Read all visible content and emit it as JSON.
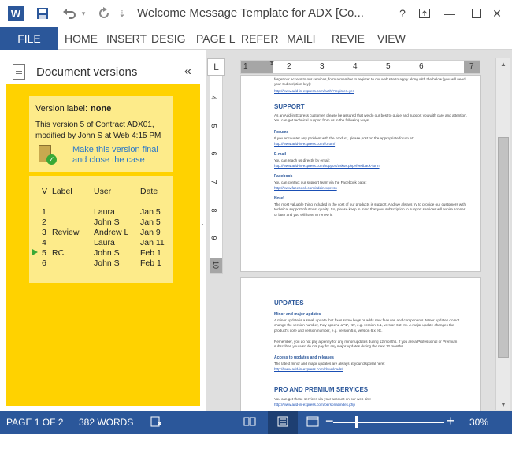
{
  "app": {
    "title": "Welcome Message Template for ADX [Co...",
    "logo_letter": "W"
  },
  "qat": {
    "save_icon": "save-icon",
    "undo_icon": "undo-icon",
    "redo_icon": "redo-icon"
  },
  "window": {
    "help": "?",
    "ribbon_display": "▣",
    "minimize": "—",
    "close": "✕"
  },
  "ribbon": {
    "file": "FILE",
    "tabs": [
      "HOME",
      "INSERT",
      "DESIG",
      "PAGE L",
      "REFER",
      "MAILI",
      "REVIE",
      "VIEW"
    ]
  },
  "pane": {
    "title": "Document versions",
    "collapse": "«",
    "version_label_prefix": "Version label:",
    "version_label_value": "none",
    "version_info": "This version 5 of Contract ADX01, modified by John S at Web 4:15 PM",
    "finalize_link": "Make this version final and close the case",
    "table": {
      "headers": [
        "V",
        "Label",
        "User",
        "Date"
      ],
      "rows": [
        {
          "v": "1",
          "label": "",
          "user": "Laura",
          "date": "Jan 5"
        },
        {
          "v": "2",
          "label": "",
          "user": "John S",
          "date": "Jan 5"
        },
        {
          "v": "3",
          "label": "Review",
          "user": "Andrew L",
          "date": "Jan 9"
        },
        {
          "v": "4",
          "label": "",
          "user": "Laura",
          "date": "Jan 11"
        },
        {
          "v": "5",
          "label": "RC",
          "user": "John S",
          "date": "Feb 1"
        },
        {
          "v": "6",
          "label": "",
          "user": "John S",
          "date": "Feb 1"
        }
      ],
      "current_row": 4
    }
  },
  "rulers": {
    "corner": "L",
    "h_ticks": [
      "1",
      "2",
      "3",
      "4",
      "5",
      "6",
      "7"
    ],
    "v_ticks": [
      "4",
      "5",
      "6",
      "7",
      "8",
      "9",
      "10"
    ]
  },
  "page1": {
    "top_text": "forget our access to our services, form a member to register to our web site to apply along with the below (you will need your Subscription key):",
    "top_link": "http://www.add-in-express.com/auth/?register=yes",
    "support_heading": "SUPPORT",
    "support_intro": "As an Add-in Express customer, please be assured that we do our best to guide and support you with care and attention. You can get technical support from us in the following ways:",
    "forums_title": "Forums",
    "forums_text": "If you encounter any problem with the product, please post on the appropriate forum at:",
    "forums_link": "http://www.add-in-express.com/forum/",
    "email_title": "E-mail",
    "email_text": "You can reach us directly by email:",
    "email_link": "http://www.add-in-express.com/support/askus.php#feedback-form",
    "facebook_title": "Facebook",
    "facebook_text": "You can contact our support team via the Facebook page:",
    "facebook_link": "http://www.facebook.com/addinexpress",
    "note_title": "Note!",
    "note_text": "The most valuable thing included in the cost of our products is support. And we always try to provide our customers with technical support of utmost quality. So, please keep in mind that your subscription to support services will expire sooner or later and you will have to renew it."
  },
  "page2": {
    "updates_heading": "UPDATES",
    "minor_title": "Minor and major updates",
    "minor_text": "A minor update is a small update that fixes some bugs or adds new features and components. Minor updates do not change the version number, they append a \"1\", \"2\", e.g. version 6.1, version 6.2 etc. A major update changes the product's core and version number, e.g. version 5.x, version 6.x etc.",
    "pay_text": "Remember, you do not pay a penny for any minor updates during 12 months. If you are a Professional or Premium subscriber, you also do not pay for any major updates during the next 12 months.",
    "access_title": "Access to updates and releases",
    "access_text": "The latest minor and major updates are always at your disposal here:",
    "access_link": "http://www.add-in-express.com/downloads/",
    "premium_heading": "PRO AND PREMIUM SERVICES",
    "premium_text": "You can get these services via your account on our web-site:",
    "premium_link": "http://www.add-in-express.com/personal/index.php"
  },
  "status": {
    "page": "PAGE 1 OF 2",
    "words": "382 WORDS",
    "zoom": "30%",
    "zoom_minus": "−",
    "zoom_plus": "+",
    "zoom_fraction": 0.21
  },
  "colors": {
    "accent": "#2b579a",
    "pane": "#ffd200",
    "card": "#fdeb8a",
    "link": "#2877c9"
  }
}
